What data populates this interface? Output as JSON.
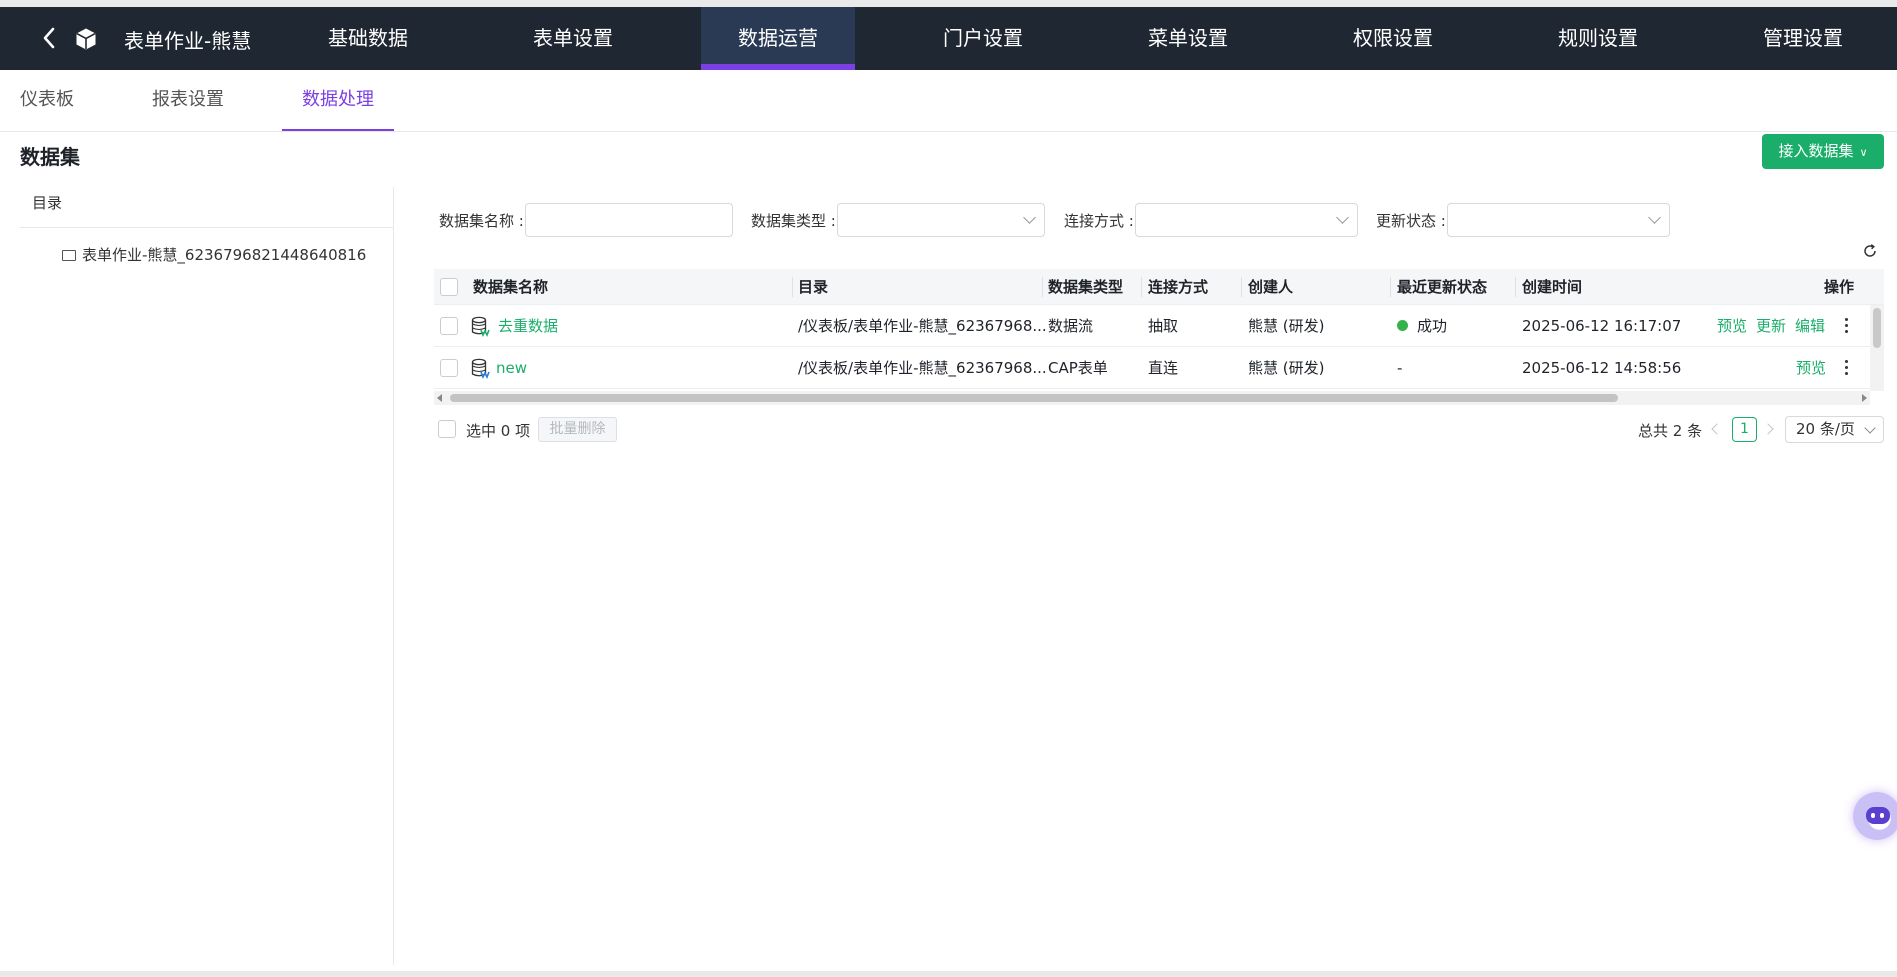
{
  "app": {
    "title": "表单作业-熊慧"
  },
  "nav": {
    "tabs": [
      "基础数据",
      "表单设置",
      "数据运营",
      "门户设置",
      "菜单设置",
      "权限设置",
      "规则设置",
      "管理设置"
    ],
    "active_tab": "数据运营"
  },
  "subnav": {
    "tabs": [
      "仪表板",
      "报表设置",
      "数据处理"
    ],
    "active_tab": "数据处理"
  },
  "page": {
    "title": "数据集",
    "import_button": "接入数据集"
  },
  "directory": {
    "header": "目录",
    "items": [
      "表单作业-熊慧_6236796821448640816"
    ]
  },
  "filters": {
    "name_label": "数据集名称 :",
    "name_value": "",
    "type_label": "数据集类型 :",
    "type_value": "",
    "connection_label": "连接方式 :",
    "connection_value": "",
    "update_label": "更新状态 :",
    "update_value": ""
  },
  "table": {
    "columns": [
      "数据集名称",
      "目录",
      "数据集类型",
      "连接方式",
      "创建人",
      "最近更新状态",
      "创建时间",
      "操作"
    ],
    "rows": [
      {
        "name": "去重数据",
        "directory": "/仪表板/表单作业-熊慧_62367968...",
        "type": "数据流",
        "connection": "抽取",
        "creator": "熊慧 (研发)",
        "status": "成功",
        "status_color": "#36b24a",
        "created": "2025-06-12 16:17:07",
        "actions": [
          "预览",
          "更新",
          "编辑"
        ]
      },
      {
        "name": "new",
        "directory": "/仪表板/表单作业-熊慧_62367968...",
        "type": "CAP表单",
        "connection": "直连",
        "creator": "熊慧 (研发)",
        "status": "-",
        "status_color": "",
        "created": "2025-06-12 14:58:56",
        "actions": [
          "预览"
        ]
      }
    ]
  },
  "footer": {
    "selected_text": "选中 0 项",
    "batch_delete": "批量删除",
    "total_text": "总共 2 条",
    "current_page": "1",
    "page_size": "20 条/页"
  },
  "colors": {
    "accent_purple": "#7b3fe4",
    "accent_green": "#1bae6a",
    "topbar_bg": "#1f2733"
  }
}
